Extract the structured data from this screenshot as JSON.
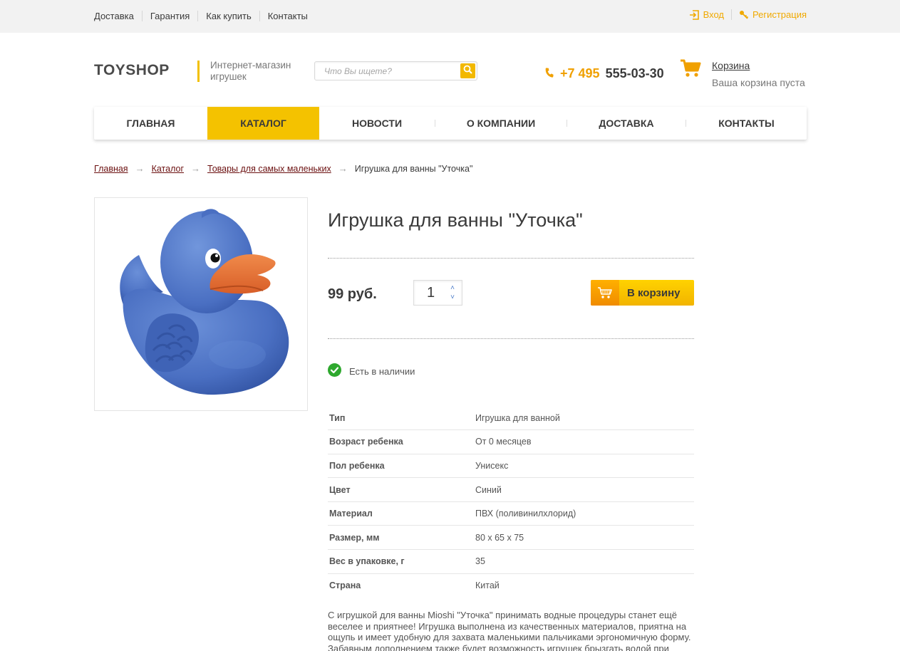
{
  "topnav": {
    "items": [
      "Доставка",
      "Гарантия",
      "Как купить",
      "Контакты"
    ]
  },
  "auth": {
    "login": "Вход",
    "register": "Регистрация"
  },
  "header": {
    "logo": "TOYSHOP",
    "tagline": "Интернет-магазин игрушек",
    "search_placeholder": "Что Вы ищете?",
    "phone_code": "+7 495",
    "phone_number": "555-03-30",
    "cart_link": "Корзина",
    "cart_status": "Ваша корзина пуста"
  },
  "mainnav": {
    "tabs": [
      {
        "label": "ГЛАВНАЯ"
      },
      {
        "label": "КАТАЛОГ"
      },
      {
        "label": "НОВОСТИ"
      },
      {
        "label": "О КОМПАНИИ"
      },
      {
        "label": "ДОСТАВКА"
      },
      {
        "label": "КОНТАКТЫ"
      }
    ],
    "active": "КАТАЛОГ"
  },
  "breadcrumb": {
    "items": [
      "Главная",
      "Каталог",
      "Товары для самых маленьких"
    ],
    "current": "Игрушка для ванны \"Уточка\""
  },
  "product": {
    "title": "Игрушка для ванны \"Уточка\"",
    "price": "99 руб.",
    "quantity": "1",
    "buy_label": "В корзину",
    "stock": "Есть в наличии",
    "specs": [
      {
        "key": "Тип",
        "value": "Игрушка для ванной"
      },
      {
        "key": "Возраст ребенка",
        "value": "От 0 месяцев"
      },
      {
        "key": "Пол ребенка",
        "value": "Унисекс"
      },
      {
        "key": "Цвет",
        "value": "Синий"
      },
      {
        "key": "Материал",
        "value": "ПВХ (поливинилхлорид)"
      },
      {
        "key": "Размер, мм",
        "value": "80 x 65 x 75"
      },
      {
        "key": "Вес в упаковке, г",
        "value": "35"
      },
      {
        "key": "Страна",
        "value": "Китай"
      }
    ],
    "description": "С игрушкой для ванны Mioshi \"Уточка\" принимать водные процедуры станет ещё веселее и приятнее! Игрушка выполнена из качественных материалов, приятна на ощупь и имеет удобную для захвата маленькими пальчиками эргономичную форму. Забавным дополнением также будет возможность игрушек брызгать водой при"
  },
  "colors": {
    "accent": "#f4c200",
    "accent_dark": "#f0a000",
    "link": "#6b1010",
    "duck_body": "#4f75c8",
    "duck_beak": "#e8743a"
  },
  "icons": {
    "login": "login-icon",
    "register": "key-icon",
    "search": "search-icon",
    "phone": "phone-icon",
    "cart": "cart-icon",
    "stock": "check-circle-icon"
  }
}
